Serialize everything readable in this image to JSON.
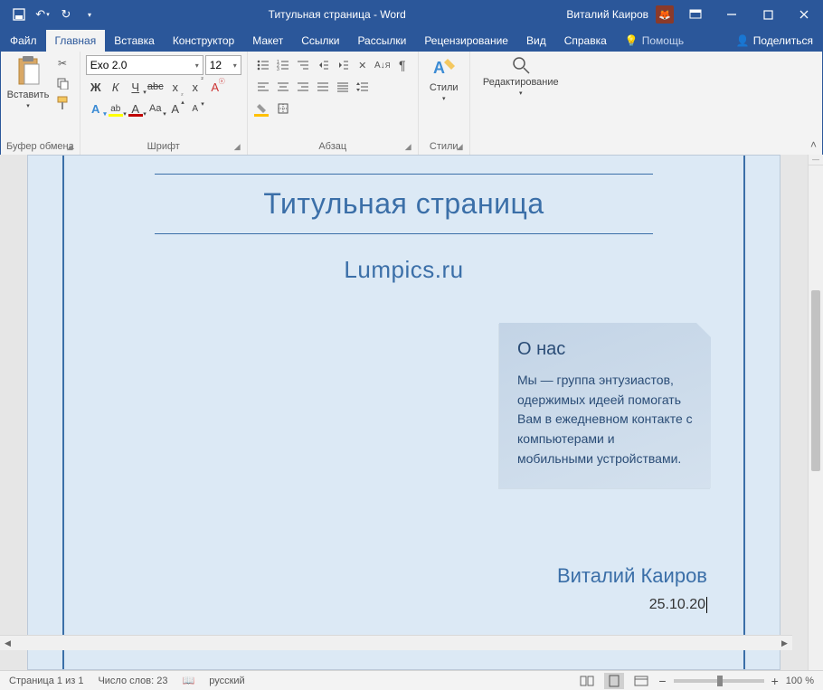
{
  "titlebar": {
    "doc_title": "Титульная страница  -  Word",
    "user_name": "Виталий Каиров"
  },
  "tabs": {
    "file": "Файл",
    "home": "Главная",
    "insert": "Вставка",
    "design": "Конструктор",
    "layout": "Макет",
    "references": "Ссылки",
    "mailings": "Рассылки",
    "review": "Рецензирование",
    "view": "Вид",
    "help": "Справка",
    "tellme": "Помощь",
    "share": "Поделиться"
  },
  "ribbon": {
    "clipboard": {
      "label": "Буфер обмена",
      "paste": "Вставить"
    },
    "font": {
      "label": "Шрифт",
      "name": "Exo 2.0",
      "size": "12",
      "bold": "Ж",
      "italic": "К",
      "underline": "Ч",
      "strike": "abc",
      "sub": "x",
      "sup": "x",
      "textfx": "A",
      "hilite": "ab",
      "color": "A",
      "case": "Aa",
      "grow": "A",
      "shrink": "A"
    },
    "paragraph": {
      "label": "Абзац"
    },
    "styles": {
      "label": "Стили",
      "btn": "Стили"
    },
    "editing": {
      "btn": "Редактирование"
    }
  },
  "document": {
    "title": "Титульная страница",
    "subtitle": "Lumpics.ru",
    "about_heading": "О нас",
    "about_body": "Мы — группа энтузиастов, одержимых идеей помогать Вам в ежедневном контакте с компьютерами и мобильными устройствами.",
    "author": "Виталий Каиров",
    "date": "25.10.20"
  },
  "status": {
    "page": "Страница 1 из 1",
    "words": "Число слов: 23",
    "lang": "русский",
    "zoom": "100 %"
  }
}
